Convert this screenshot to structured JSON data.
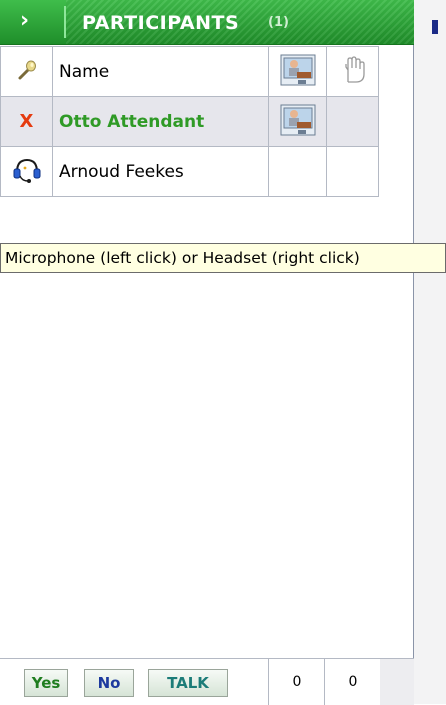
{
  "panel": {
    "header": {
      "chevron": "›",
      "title": "PARTICIPANTS",
      "count": "(1)"
    },
    "columns": {
      "name_label": "Name"
    },
    "participants": [
      {
        "name": "Otto Attendant",
        "status": "X",
        "highlighted": true,
        "has_camera": true
      },
      {
        "name": "Arnoud Feekes",
        "status": "headset",
        "highlighted": false,
        "has_camera": false
      }
    ],
    "tooltip": "Microphone (left click) or Headset (right click)",
    "footer": {
      "yes_label": "Yes",
      "no_label": "No",
      "talk_label": "TALK",
      "yes_count": "0",
      "no_count": "0"
    }
  },
  "colors": {
    "header_green": "#2a9d35",
    "name_green": "#2f9a26",
    "x_red": "#e53b10",
    "tooltip_bg": "#ffffe1"
  }
}
